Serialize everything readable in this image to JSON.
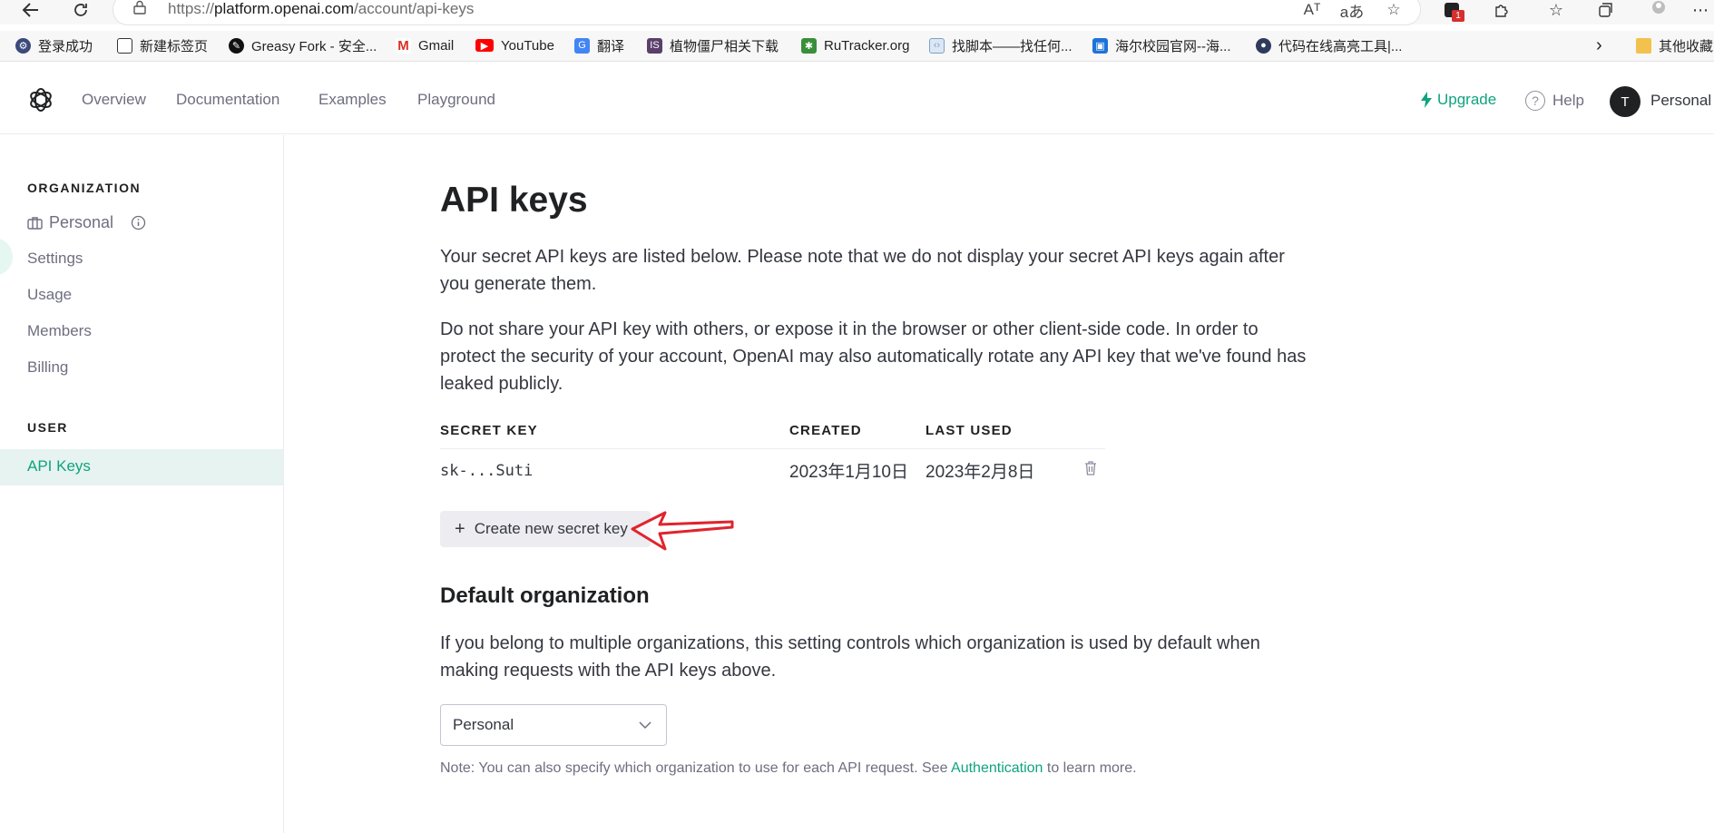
{
  "browser": {
    "url_prefix": "https://",
    "url_host": "platform.openai.com",
    "url_path": "/account/api-keys",
    "read_aloud_icon": "Aᵀ",
    "translate_icon": "aあ",
    "extension_badge": "1",
    "bookmarks": [
      {
        "label": "登录成功",
        "icon": "gear-icon",
        "color": "#3b4a7a"
      },
      {
        "label": "新建标签页",
        "icon": "tab-icon",
        "color": "#333333"
      },
      {
        "label": "Greasy Fork - 安全...",
        "icon": "greasyfork-icon",
        "color": "#111111"
      },
      {
        "label": "Gmail",
        "icon": "gmail-icon",
        "color": "#d93025"
      },
      {
        "label": "YouTube",
        "icon": "youtube-icon",
        "color": "#ff0000"
      },
      {
        "label": "翻译",
        "icon": "translate-icon",
        "color": "#4285f4"
      },
      {
        "label": "植物僵尸相关下载",
        "icon": "book-icon",
        "color": "#5a3f6b"
      },
      {
        "label": "RuTracker.org",
        "icon": "rutracker-icon",
        "color": "#3a8f3a"
      },
      {
        "label": "找脚本——找任何...",
        "icon": "page-icon",
        "color": "#7da0c8"
      },
      {
        "label": "海尔校园官网--海...",
        "icon": "haier-icon",
        "color": "#1e73d8"
      },
      {
        "label": "代码在线高亮工具|...",
        "icon": "code-icon",
        "color": "#2f3b5c"
      }
    ],
    "other_bookmarks": "其他收藏"
  },
  "header": {
    "nav": [
      "Overview",
      "Documentation",
      "Examples",
      "Playground"
    ],
    "upgrade": "Upgrade",
    "help": "Help",
    "help_icon_glyph": "?",
    "avatar_initial": "T",
    "account": "Personal"
  },
  "sidebar": {
    "org_heading": "ORGANIZATION",
    "org_name": "Personal",
    "items": [
      "Settings",
      "Usage",
      "Members",
      "Billing"
    ],
    "user_heading": "USER",
    "active_item": "API Keys"
  },
  "main": {
    "title": "API keys",
    "intro": "Your secret API keys are listed below. Please note that we do not display your secret API keys again after you generate them.",
    "warning": "Do not share your API key with others, or expose it in the browser or other client-side code. In order to protect the security of your account, OpenAI may also automatically rotate any API key that we've found has leaked publicly.",
    "table": {
      "headers": [
        "SECRET KEY",
        "CREATED",
        "LAST USED"
      ],
      "rows": [
        {
          "key": "sk-...Suti",
          "created": "2023年1月10日",
          "last_used": "2023年2月8日"
        }
      ]
    },
    "create_button": "Create new secret key",
    "create_plus": "+",
    "default_org_title": "Default organization",
    "default_org_desc": "If you belong to multiple organizations, this setting controls which organization is used by default when making requests with the API keys above.",
    "org_select_value": "Personal",
    "note_prefix": "Note: You can also specify which organization to use for each API request. See ",
    "note_link": "Authentication",
    "note_suffix": " to learn more."
  },
  "colors": {
    "accent": "#10a37f",
    "annotation_arrow": "#e0242d"
  }
}
